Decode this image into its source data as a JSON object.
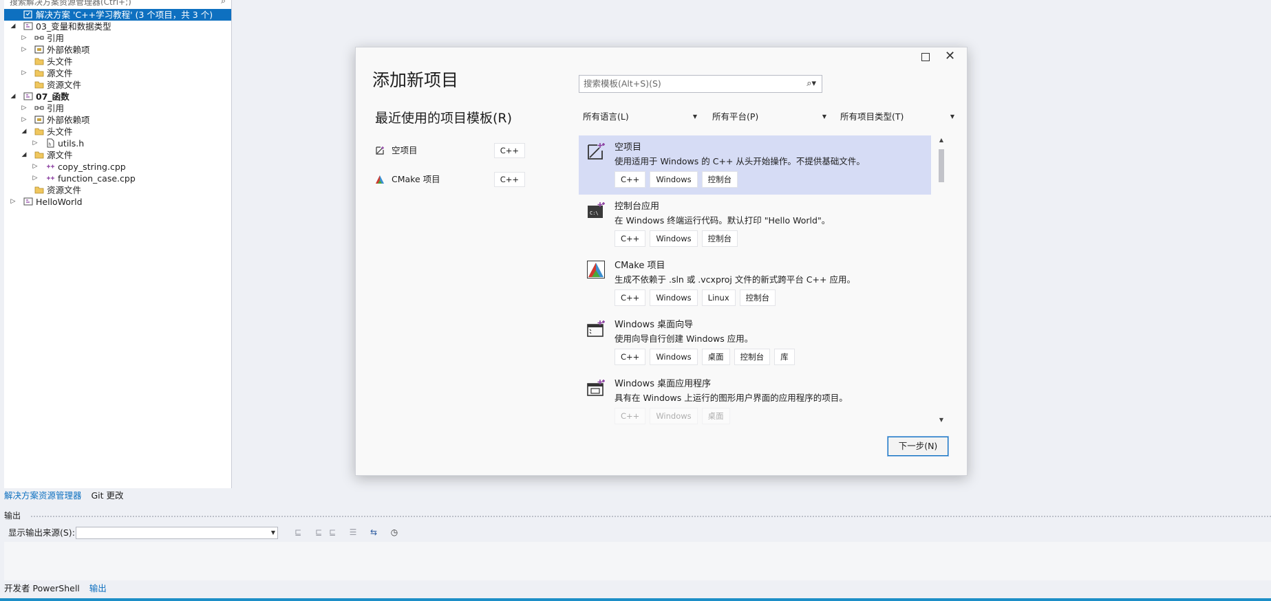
{
  "solution_explorer": {
    "search_placeholder": "搜索解决方案资源管理器(Ctrl+;)",
    "tree": [
      {
        "label": "解决方案 'C++学习教程' (3 个项目，共 3 个)",
        "level": 0,
        "expander": "none",
        "icon": "solution-icon",
        "selected": true,
        "bold": false
      },
      {
        "label": "03_变量和数据类型",
        "level": 1,
        "expander": "expanded",
        "icon": "cpp-project-icon",
        "selected": false,
        "bold": false
      },
      {
        "label": "引用",
        "level": 2,
        "expander": "collapsed",
        "icon": "references-icon",
        "selected": false,
        "bold": false
      },
      {
        "label": "外部依赖项",
        "level": 2,
        "expander": "collapsed",
        "icon": "external-deps-icon",
        "selected": false,
        "bold": false
      },
      {
        "label": "头文件",
        "level": 2,
        "expander": "none",
        "icon": "filter-folder-icon",
        "selected": false,
        "bold": false
      },
      {
        "label": "源文件",
        "level": 2,
        "expander": "collapsed",
        "icon": "filter-folder-icon",
        "selected": false,
        "bold": false
      },
      {
        "label": "资源文件",
        "level": 2,
        "expander": "none",
        "icon": "filter-folder-icon",
        "selected": false,
        "bold": false
      },
      {
        "label": "07_函数",
        "level": 1,
        "expander": "expanded",
        "icon": "cpp-project-icon",
        "selected": false,
        "bold": true
      },
      {
        "label": "引用",
        "level": 2,
        "expander": "collapsed",
        "icon": "references-icon",
        "selected": false,
        "bold": false
      },
      {
        "label": "外部依赖项",
        "level": 2,
        "expander": "collapsed",
        "icon": "external-deps-icon",
        "selected": false,
        "bold": false
      },
      {
        "label": "头文件",
        "level": 2,
        "expander": "expanded",
        "icon": "filter-folder-icon",
        "selected": false,
        "bold": false
      },
      {
        "label": "utils.h",
        "level": 3,
        "expander": "collapsed",
        "icon": "header-file-icon",
        "selected": false,
        "bold": false
      },
      {
        "label": "源文件",
        "level": 2,
        "expander": "expanded",
        "icon": "filter-folder-icon",
        "selected": false,
        "bold": false
      },
      {
        "label": "copy_string.cpp",
        "level": 3,
        "expander": "collapsed",
        "icon": "cpp-file-icon",
        "selected": false,
        "bold": false
      },
      {
        "label": "function_case.cpp",
        "level": 3,
        "expander": "collapsed",
        "icon": "cpp-file-icon",
        "selected": false,
        "bold": false
      },
      {
        "label": "资源文件",
        "level": 2,
        "expander": "none",
        "icon": "filter-folder-icon",
        "selected": false,
        "bold": false
      },
      {
        "label": "HelloWorld",
        "level": 1,
        "expander": "collapsed",
        "icon": "cpp-project-icon",
        "selected": false,
        "bold": false
      }
    ],
    "tabs": [
      {
        "label": "解决方案资源管理器",
        "active": true
      },
      {
        "label": "Git 更改",
        "active": false
      }
    ]
  },
  "output_panel": {
    "title": "输出",
    "source_label": "显示输出来源(S):",
    "source_value": "",
    "toolbar_icons": [
      "find-message-icon",
      "prev-message-icon",
      "next-message-icon",
      "clear-all-icon",
      "toggle-word-wrap-icon",
      "clock-icon"
    ]
  },
  "bottom_tabs": [
    {
      "label": "开发者 PowerShell",
      "active": false
    },
    {
      "label": "输出",
      "active": true
    }
  ],
  "dialog": {
    "title": "添加新项目",
    "recent_title": "最近使用的项目模板(R)",
    "recent": [
      {
        "label": "空项目",
        "tag": "C++",
        "icon": "empty-project-icon"
      },
      {
        "label": "CMake 项目",
        "tag": "C++",
        "icon": "cmake-icon"
      }
    ],
    "search_placeholder": "搜索模板(Alt+S)(S)",
    "filters": {
      "language": "所有语言(L)",
      "platform": "所有平台(P)",
      "project_type": "所有项目类型(T)"
    },
    "templates": [
      {
        "name": "空项目",
        "desc": "使用适用于 Windows 的 C++ 从头开始操作。不提供基础文件。",
        "tags": [
          "C++",
          "Windows",
          "控制台"
        ],
        "icon": "empty-project-icon",
        "selected": true
      },
      {
        "name": "控制台应用",
        "desc": "在 Windows 终端运行代码。默认打印 \"Hello World\"。",
        "tags": [
          "C++",
          "Windows",
          "控制台"
        ],
        "icon": "console-app-icon",
        "selected": false
      },
      {
        "name": "CMake 项目",
        "desc": "生成不依赖于 .sln 或 .vcxproj 文件的新式跨平台 C++ 应用。",
        "tags": [
          "C++",
          "Windows",
          "Linux",
          "控制台"
        ],
        "icon": "cmake-icon",
        "selected": false
      },
      {
        "name": "Windows 桌面向导",
        "desc": "使用向导自行创建 Windows 应用。",
        "tags": [
          "C++",
          "Windows",
          "桌面",
          "控制台",
          "库"
        ],
        "icon": "desktop-wizard-icon",
        "selected": false
      },
      {
        "name": "Windows 桌面应用程序",
        "desc": "具有在 Windows 上运行的图形用户界面的应用程序的项目。",
        "tags": [
          "C++",
          "Windows",
          "桌面"
        ],
        "icon": "desktop-app-icon",
        "selected": false
      }
    ],
    "next_button": "下一步(N)"
  },
  "colors": {
    "accent": "#0e70c0",
    "selected_template_bg": "#d6dcf5",
    "status_bar": "#1c8ec7"
  }
}
